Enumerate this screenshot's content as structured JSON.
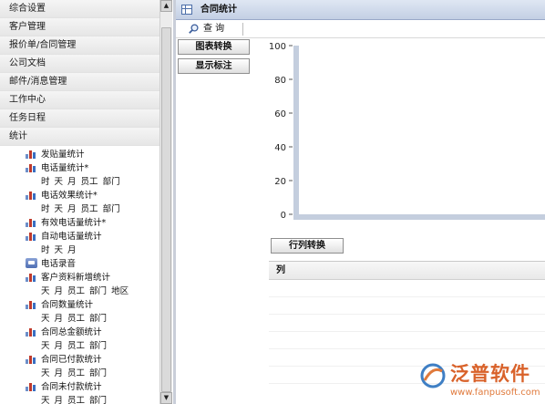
{
  "sidebar": {
    "menu": [
      {
        "label": "综合设置"
      },
      {
        "label": "客户管理"
      },
      {
        "label": "报价单/合同管理"
      },
      {
        "label": "公司文档"
      },
      {
        "label": "邮件/消息管理"
      },
      {
        "label": "工作中心"
      },
      {
        "label": "任务日程"
      },
      {
        "label": "统计"
      }
    ],
    "tree": [
      {
        "label": "发贴量统计",
        "icon": "bar-chart-icon",
        "sub": ""
      },
      {
        "label": "电话量统计*",
        "icon": "bar-chart-icon",
        "sub": "时 天 月 员工 部门"
      },
      {
        "label": "电话效果统计*",
        "icon": "bar-chart-icon",
        "sub": "时 天 月 员工 部门"
      },
      {
        "label": "有效电话量统计*",
        "icon": "bar-chart-icon",
        "sub": ""
      },
      {
        "label": "自动电话量统计",
        "icon": "bar-chart-icon",
        "sub": "时 天 月"
      },
      {
        "label": "电话录音",
        "icon": "phone-icon",
        "sub": ""
      },
      {
        "label": "客户资料新增统计",
        "icon": "bar-chart-icon",
        "sub": "天 月 员工 部门 地区"
      },
      {
        "label": "合同数量统计",
        "icon": "bar-chart-icon",
        "sub": "天 月 员工 部门"
      },
      {
        "label": "合同总金额统计",
        "icon": "bar-chart-icon",
        "sub": "天 月 员工 部门"
      },
      {
        "label": "合同已付款统计",
        "icon": "bar-chart-icon",
        "sub": "天 月 员工 部门"
      },
      {
        "label": "合同未付款统计",
        "icon": "bar-chart-icon",
        "sub": "天 月 员工 部门"
      }
    ]
  },
  "main": {
    "title": "合同统计",
    "toolbar": {
      "search_label": "查 询"
    },
    "buttons": {
      "chart_switch": "图表转换",
      "show_labels": "显示标注",
      "rowcol_switch": "行列转换"
    },
    "grid": {
      "column_header": "列"
    }
  },
  "chart_data": {
    "type": "bar",
    "categories": [],
    "values": [],
    "ylim": [
      0,
      100
    ],
    "yticks": [
      "0",
      "20",
      "40",
      "60",
      "80",
      "100"
    ],
    "grid": false
  },
  "watermark": {
    "brand": "泛普软件",
    "url": "www.fanpusoft.com",
    "colors": {
      "brand": "#d9622a",
      "url": "#e07a3c"
    }
  },
  "colors": {
    "axis": "#c4cede",
    "title_bar": "#c3cfe4"
  }
}
